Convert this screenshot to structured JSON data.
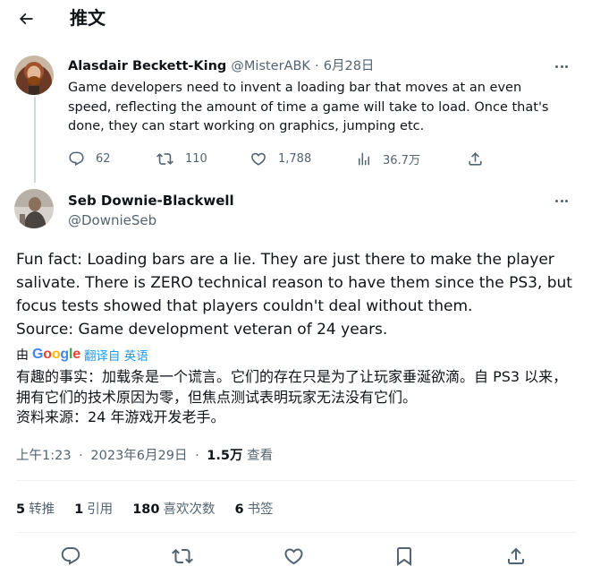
{
  "header": {
    "title": "推文",
    "back_icon": "arrow-left-icon"
  },
  "tweet1": {
    "name": "Alasdair Beckett-King",
    "handle": "@MisterABK",
    "separator": "·",
    "date": "6月28日",
    "text": "Game developers need to invent a loading bar that moves at an even speed, reflecting the amount of time a game will take to load. Once that's done, they can start working on graphics, jumping etc.",
    "actions": {
      "replies": "62",
      "retweets": "110",
      "likes": "1,788",
      "views": "36.7万"
    }
  },
  "tweet2": {
    "name": "Seb Downie-Blackwell",
    "handle": "@DownieSeb",
    "text": "Fun fact: Loading bars are a lie. They are just there to make the player salivate. There is ZERO technical reason to have them since the PS3, but focus tests showed that players couldn't deal without them.\nSource: Game development veteran of 24 years.",
    "translation_bar": {
      "by": "由",
      "google_letters": [
        "G",
        "o",
        "o",
        "g",
        "l",
        "e"
      ],
      "link": "翻译自 英语"
    },
    "translated_text": "有趣的事实：加载条是一个谎言。它们的存在只是为了让玩家垂涎欲滴。自 PS3 以来，拥有它们的技术原因为零，但焦点测试表明玩家无法没有它们。\n资料来源：24 年游戏开发老手。",
    "meta": {
      "time": "上午1:23",
      "separator1": "·",
      "date": "2023年6月29日",
      "separator2": "·",
      "views_count": "1.5万",
      "views_label": "查看"
    },
    "stats": [
      {
        "count": "5",
        "label": "转推"
      },
      {
        "count": "1",
        "label": "引用"
      },
      {
        "count": "180",
        "label": "喜欢次数"
      },
      {
        "count": "6",
        "label": "书签"
      }
    ]
  },
  "colors": {
    "google_blue": "#4285f4",
    "google_red": "#ea4335",
    "google_yellow": "#fbbc05",
    "google_green": "#34a853",
    "link_blue": "#1d9bf0",
    "muted_gray": "#536471"
  },
  "icons": {
    "reply": "reply-icon",
    "retweet": "retweet-icon",
    "like": "heart-icon",
    "views": "views-icon",
    "share": "share-icon",
    "bookmark": "bookmark-icon",
    "more": "more-icon"
  }
}
